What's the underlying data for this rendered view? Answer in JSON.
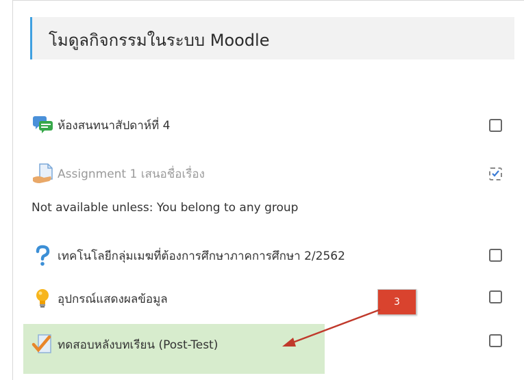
{
  "section": {
    "title": "โมดูลกิจกรรมในระบบ Moodle"
  },
  "activities": [
    {
      "label": "ห้องสนทนาสัปดาห์ที่ 4",
      "icon": "chat-bubbles-icon",
      "completed": false,
      "dimmed": false
    },
    {
      "label": "Assignment 1 เสนอชื่อเรื่อง",
      "icon": "assignment-document-icon",
      "completed": true,
      "dimmed": true
    },
    {
      "label": "เทคโนโลยีกลุ่มเมฆที่ต้องการศึกษาภาคการศึกษา 2/2562",
      "icon": "question-mark-icon",
      "completed": false,
      "dimmed": false
    },
    {
      "label": "อุปกรณ์แสดงผลข้อมูล",
      "icon": "lightbulb-icon",
      "completed": false,
      "dimmed": false
    },
    {
      "label": "ทดสอบหลังบทเรียน (Post-Test)",
      "icon": "quiz-checkmark-icon",
      "completed": false,
      "dimmed": false
    }
  ],
  "restriction": {
    "text": "Not available unless: You belong to any group"
  },
  "annotation": {
    "label": "3"
  },
  "colors": {
    "section_accent": "#3fa0e0",
    "highlight": "#d7eccd",
    "callout": "#d9432e",
    "arrow": "#c0392b"
  }
}
